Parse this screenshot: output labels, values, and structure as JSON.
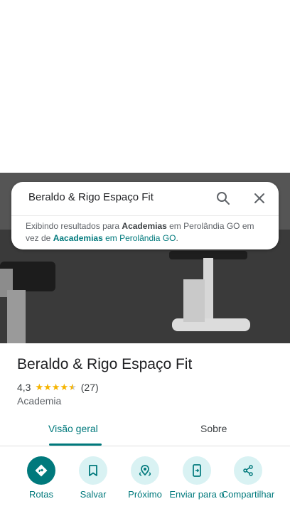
{
  "search": {
    "query": "Beraldo & Rigo Espaço Fit",
    "notice": {
      "prefix": "Exibindo resultados para ",
      "term_shown": "Academias",
      "location_shown": " em Perolândia GO",
      "middle": " em vez de ",
      "term_original": "Aacademias",
      "location_original": " em Perolândia GO",
      "suffix": "."
    }
  },
  "place": {
    "name": "Beraldo & Rigo Espaço Fit",
    "rating": "4,3",
    "rating_value": 4.3,
    "reviews": "(27)",
    "category": "Academia"
  },
  "tabs": [
    {
      "label": "Visão geral",
      "active": true
    },
    {
      "label": "Sobre",
      "active": false
    }
  ],
  "actions": [
    {
      "label": "Rotas",
      "icon": "directions-icon"
    },
    {
      "label": "Salvar",
      "icon": "bookmark-icon"
    },
    {
      "label": "Próximo",
      "icon": "nearby-icon"
    },
    {
      "label": "Enviar para o",
      "icon": "send-to-phone-icon"
    },
    {
      "label": "Compartilhar",
      "icon": "share-icon"
    }
  ],
  "colors": {
    "accent": "#00797c",
    "accent_light": "#d9f2f3",
    "star": "#f6b400"
  }
}
